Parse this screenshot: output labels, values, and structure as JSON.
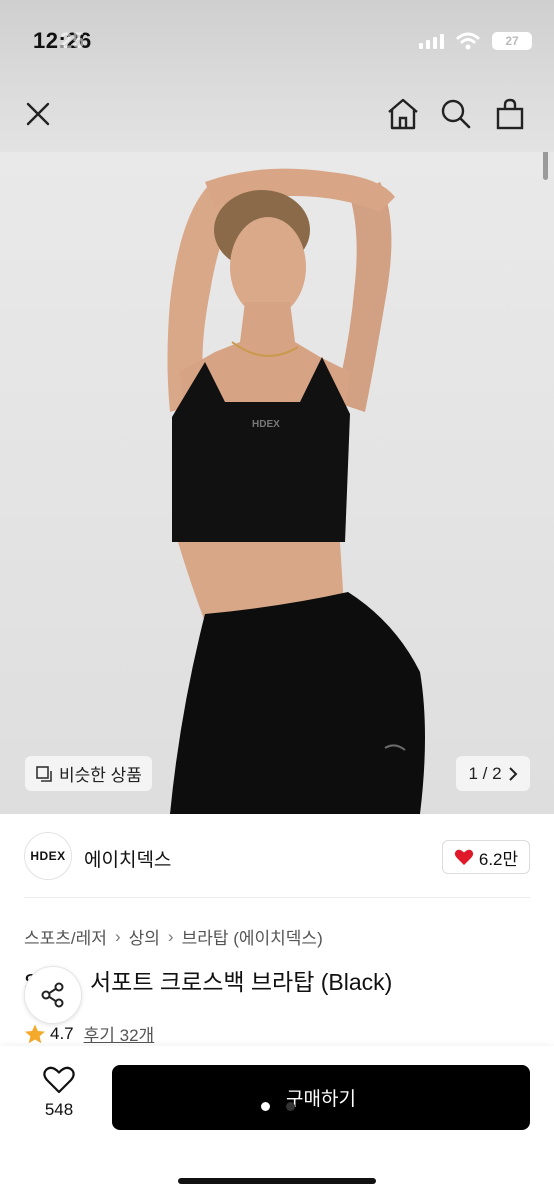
{
  "status_bar": {
    "time": "12:26",
    "time_ghost": "25",
    "battery": "27"
  },
  "hero": {
    "image_logo": "HDEX",
    "similar_label": "비슷한 상품",
    "pager": "1 / 2"
  },
  "brand": {
    "logo_text": "HDEX",
    "name": "에이치덱스",
    "likes": "6.2만"
  },
  "breadcrumb": [
    "스포츠/레저",
    "상의",
    "브라탑 (에이치덱스)"
  ],
  "product": {
    "title_prefix": "S  스",
    "title": "서포트 크로스백 브라탑 (Black)",
    "rating": "4.7",
    "review_link": "후기 32개"
  },
  "bottom": {
    "wish_count": "548",
    "buy_label": "구매하기"
  },
  "colors": {
    "accent": "#000000",
    "heart": "#e0192a",
    "star": "#f4a92a"
  }
}
